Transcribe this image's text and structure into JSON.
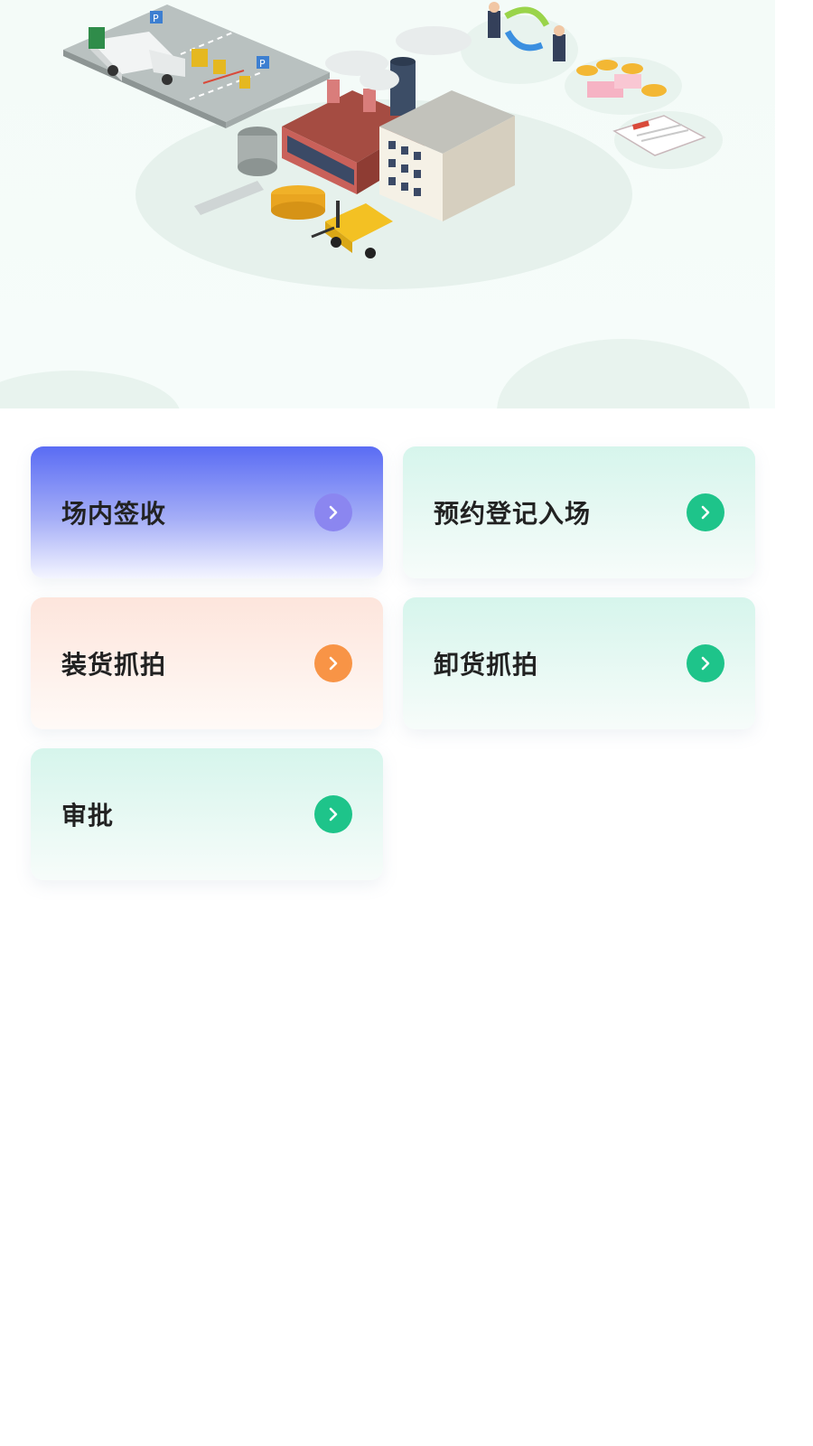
{
  "hero": {
    "illustration": "factory-logistics-illustration"
  },
  "menu": {
    "items": [
      {
        "label": "场内签收",
        "icon": "chevron-right-icon",
        "arrow_color": "#8b86f0"
      },
      {
        "label": "预约登记入场",
        "icon": "chevron-right-icon",
        "arrow_color": "#1ec48a"
      },
      {
        "label": "装货抓拍",
        "icon": "chevron-right-icon",
        "arrow_color": "#f89446"
      },
      {
        "label": "卸货抓拍",
        "icon": "chevron-right-icon",
        "arrow_color": "#1ec48a"
      },
      {
        "label": "审批",
        "icon": "chevron-right-icon",
        "arrow_color": "#1ec48a"
      }
    ]
  }
}
